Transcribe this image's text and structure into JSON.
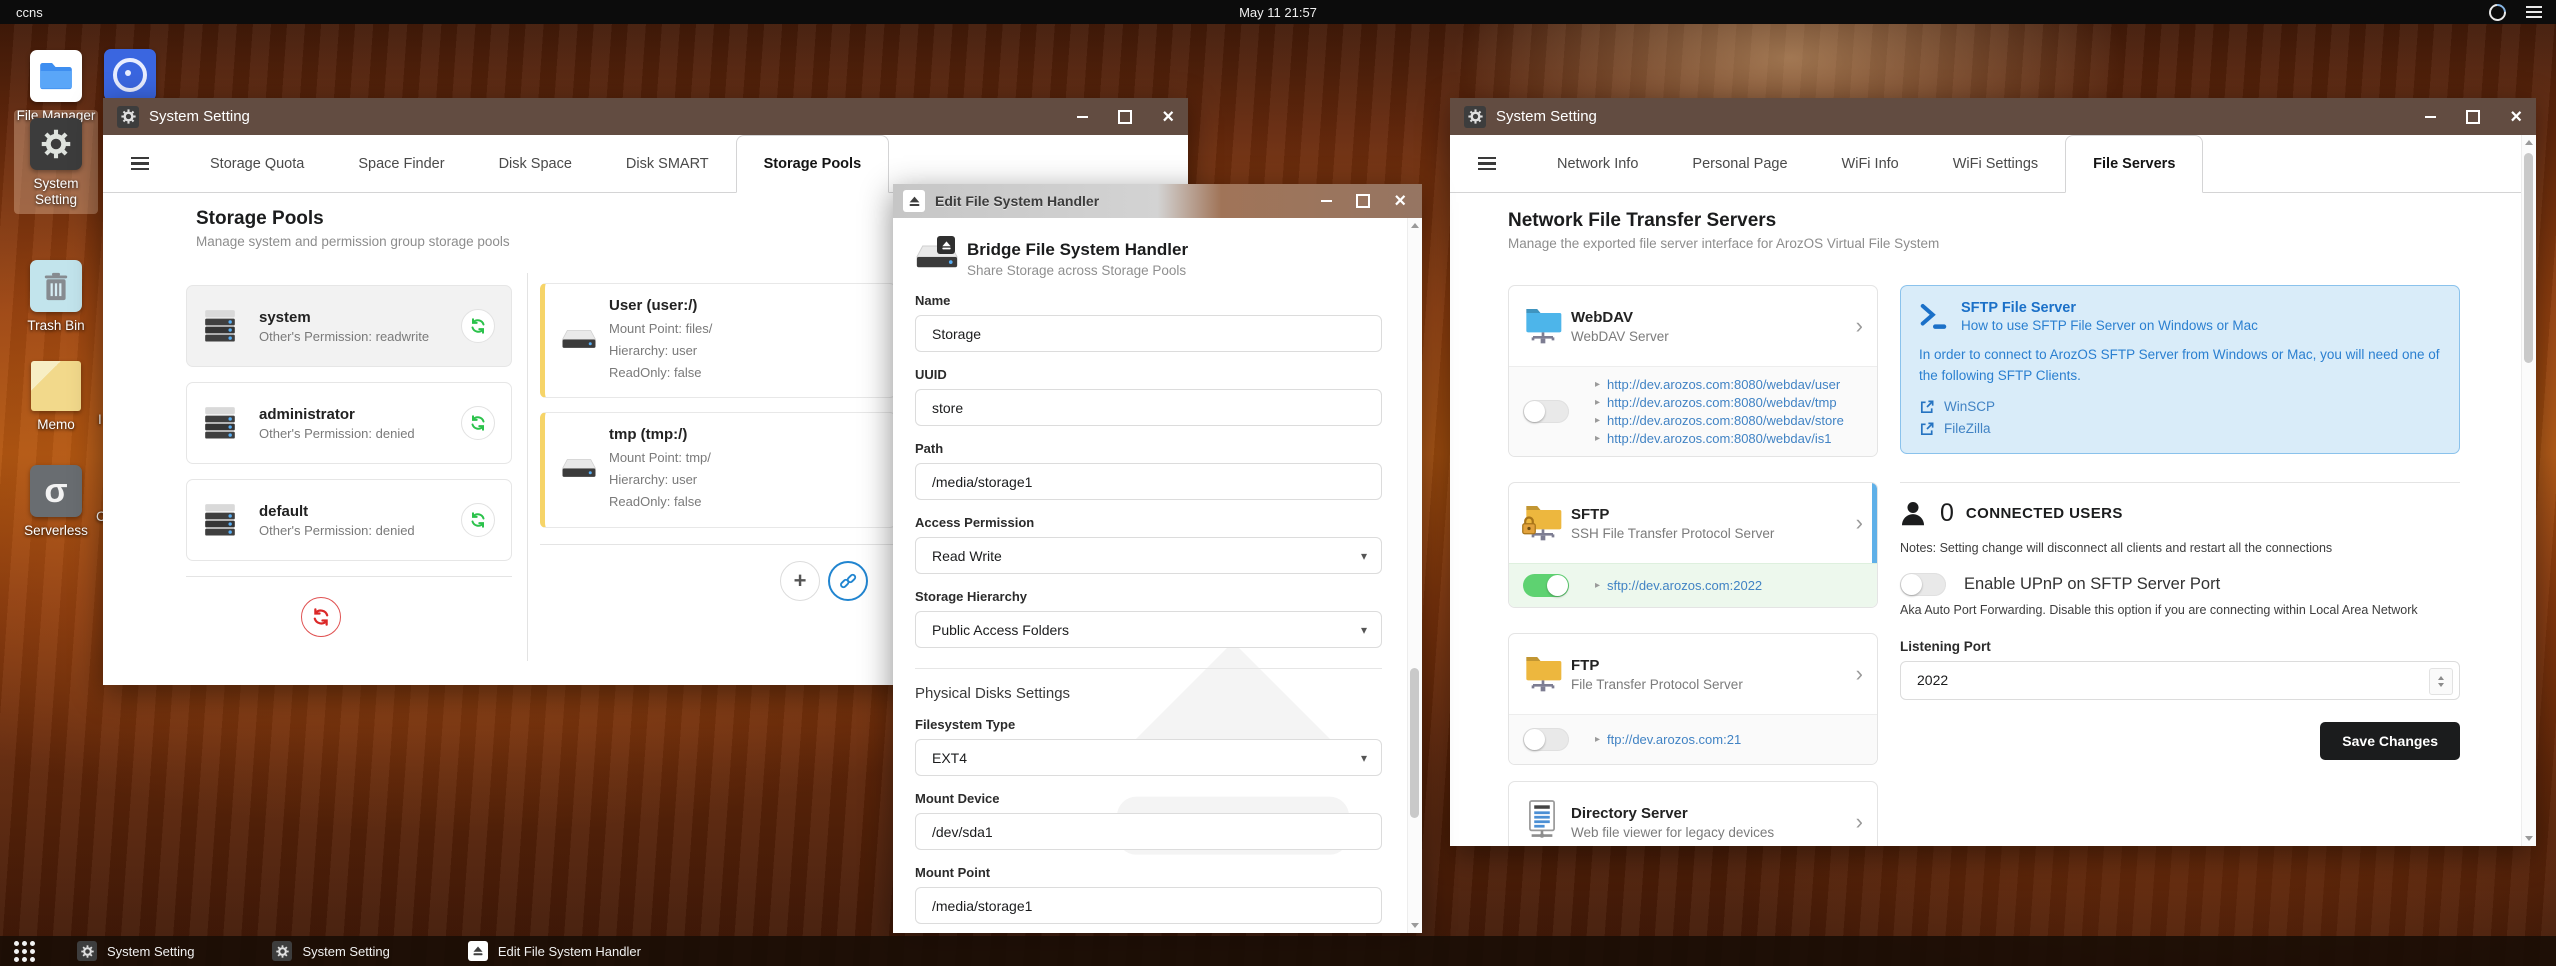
{
  "colors": {
    "accent": "#2185d0",
    "green": "#21ba45",
    "red": "#db2828",
    "dark_button": "#1b1c1d",
    "mount_yellow": "#f6d468",
    "info_blue_bg": "#d9ecf9"
  },
  "menubar": {
    "host": "ccns",
    "clock": "May 11 21:57"
  },
  "desktop": {
    "icons": [
      {
        "label": "File Manager"
      },
      {
        "label": "System Setting"
      },
      {
        "label": "Trash Bin"
      },
      {
        "label": "Memo"
      },
      {
        "label": "Serverless"
      }
    ],
    "partial_labels": {
      "memo_row": "I",
      "serverless_row": "C"
    }
  },
  "window_storage": {
    "title": "System Setting",
    "tabs": [
      {
        "label": "Storage Quota"
      },
      {
        "label": "Space Finder"
      },
      {
        "label": "Disk Space"
      },
      {
        "label": "Disk SMART"
      },
      {
        "label": "Storage Pools"
      }
    ],
    "heading": "Storage Pools",
    "subheading": "Manage system and permission group storage pools",
    "pools": [
      {
        "name": "system",
        "permission": "Other's Permission: readwrite"
      },
      {
        "name": "administrator",
        "permission": "Other's Permission: denied"
      },
      {
        "name": "default",
        "permission": "Other's Permission: denied"
      }
    ],
    "mounts": [
      {
        "name": "User (user:/)",
        "mount_point": "Mount Point: files/",
        "hierarchy": "Hierarchy: user",
        "readonly": "ReadOnly: false"
      },
      {
        "name": "tmp (tmp:/)",
        "mount_point": "Mount Point: tmp/",
        "hierarchy": "Hierarchy: user",
        "readonly": "ReadOnly: false"
      }
    ]
  },
  "window_edit": {
    "title": "Edit File System Handler",
    "heading": "Bridge File System Handler",
    "subheading": "Share Storage across Storage Pools",
    "name_label": "Name",
    "name_value": "Storage",
    "uuid_label": "UUID",
    "uuid_value": "store",
    "path_label": "Path",
    "path_value": "/media/storage1",
    "access_label": "Access Permission",
    "access_value": "Read Write",
    "hierarchy_label": "Storage Hierarchy",
    "hierarchy_value": "Public Access Folders",
    "section_label": "Physical Disks Settings",
    "fstype_label": "Filesystem Type",
    "fstype_value": "EXT4",
    "mount_device_label": "Mount Device",
    "mount_device_value": "/dev/sda1",
    "mount_point_label": "Mount Point",
    "mount_point_value": "/media/storage1"
  },
  "window_servers": {
    "title": "System Setting",
    "tabs": [
      {
        "label": "Network Info"
      },
      {
        "label": "Personal Page"
      },
      {
        "label": "WiFi Info"
      },
      {
        "label": "WiFi Settings"
      },
      {
        "label": "File Servers"
      }
    ],
    "heading": "Network File Transfer Servers",
    "subheading": "Manage the exported file server interface for ArozOS Virtual File System",
    "webdav": {
      "name": "WebDAV",
      "desc": "WebDAV Server",
      "links": [
        "http://dev.arozos.com:8080/webdav/user",
        "http://dev.arozos.com:8080/webdav/tmp",
        "http://dev.arozos.com:8080/webdav/store",
        "http://dev.arozos.com:8080/webdav/is1"
      ]
    },
    "sftp": {
      "name": "SFTP",
      "desc": "SSH File Transfer Protocol Server",
      "link": "sftp://dev.arozos.com:2022"
    },
    "ftp": {
      "name": "FTP",
      "desc": "File Transfer Protocol Server",
      "link": "ftp://dev.arozos.com:21"
    },
    "dirserver": {
      "name": "Directory Server",
      "desc": "Web file viewer for legacy devices"
    },
    "sftp_help": {
      "title": "SFTP File Server",
      "subtitle": "How to use SFTP File Server on Windows or Mac",
      "body": "In order to connect to ArozOS SFTP Server from Windows or Mac, you will need one of the following SFTP Clients.",
      "clients": [
        {
          "label": "WinSCP"
        },
        {
          "label": "FileZilla"
        }
      ]
    },
    "connected": {
      "count": "0",
      "label": "CONNECTED USERS",
      "notes": "Notes: Setting change will disconnect all clients and restart all the connections"
    },
    "upnp": {
      "label": "Enable UPnP on SFTP Server Port",
      "desc": "Aka Auto Port Forwarding. Disable this option if you are connecting within Local Area Network"
    },
    "port": {
      "label": "Listening Port",
      "value": "2022"
    },
    "save_label": "Save Changes"
  },
  "taskbar": {
    "items": [
      {
        "label": "System Setting"
      },
      {
        "label": "System Setting"
      },
      {
        "label": "Edit File System Handler"
      }
    ]
  }
}
